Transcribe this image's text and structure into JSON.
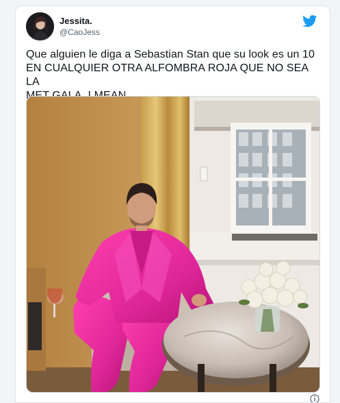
{
  "tweet": {
    "author_name": "Jessita.",
    "author_handle": "@CaoJess",
    "text_lines": [
      "Que alguien le diga a Sebastian Stan que su look es un 10",
      "EN CUALQUIER OTRA ALFOMBRA ROJA QUE NO SEA LA",
      "MET GALA. I MEAN........."
    ],
    "platform_icon": "twitter-bird-icon",
    "brand_color": "#1d9bf0"
  },
  "photo": {
    "subject": "man in pink suit seated in armchair by window"
  },
  "footer": {
    "more_icon": "info-icon"
  }
}
